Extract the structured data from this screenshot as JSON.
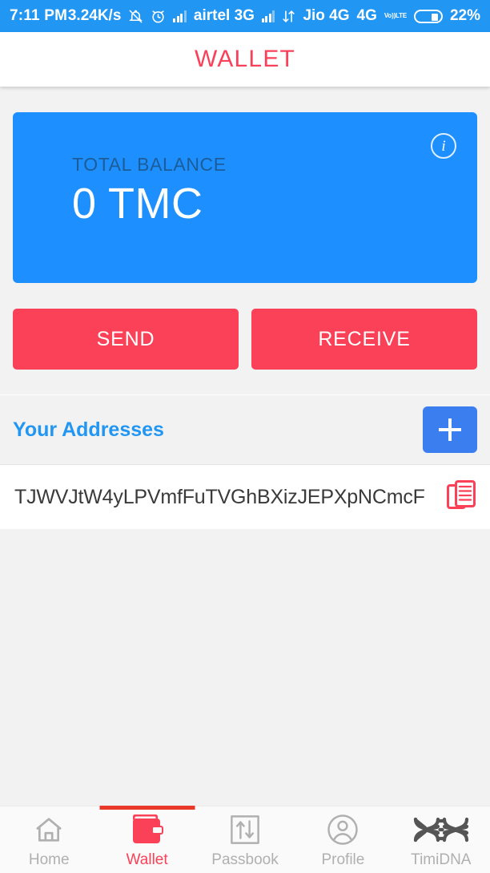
{
  "statusbar": {
    "time": "7:11 PM",
    "network_speed": "3.24K/s",
    "icons": [
      "notifications-off-icon",
      "alarm-icon",
      "signal-icon",
      "signal-icon",
      "data-transfer-icon",
      "volte-icon"
    ],
    "carrier1": "airtel 3G",
    "carrier2": "Jio 4G",
    "network_type": "4G",
    "volte_top": "Vo))",
    "volte_bottom": "LTE",
    "battery_percent": "22%"
  },
  "header": {
    "title": "WALLET",
    "title_color": "#f8415a"
  },
  "balance_card": {
    "label": "TOTAL BALANCE",
    "value": "0 TMC",
    "info_glyph": "i",
    "bg_color": "#1e8fff"
  },
  "actions": {
    "send_label": "SEND",
    "receive_label": "RECEIVE",
    "button_color": "#fb4158"
  },
  "addresses": {
    "section_title": "Your Addresses",
    "section_title_color": "#2196f3",
    "add_button_color": "#3b7ef0",
    "items": [
      {
        "address": "TJWVJtW4yLPVmfFuTVGhBXizJEPXpNCmcF",
        "copy_icon": "copy-icon"
      }
    ]
  },
  "bottom_nav": {
    "active_index": 1,
    "active_color": "#fb4158",
    "indicator_color": "#e8392b",
    "inactive_color": "#b0b0b0",
    "items": [
      {
        "label": "Home",
        "icon": "home-icon"
      },
      {
        "label": "Wallet",
        "icon": "wallet-icon"
      },
      {
        "label": "Passbook",
        "icon": "passbook-icon"
      },
      {
        "label": "Profile",
        "icon": "profile-icon"
      },
      {
        "label": "TimiDNA",
        "icon": "dna-icon"
      }
    ]
  }
}
